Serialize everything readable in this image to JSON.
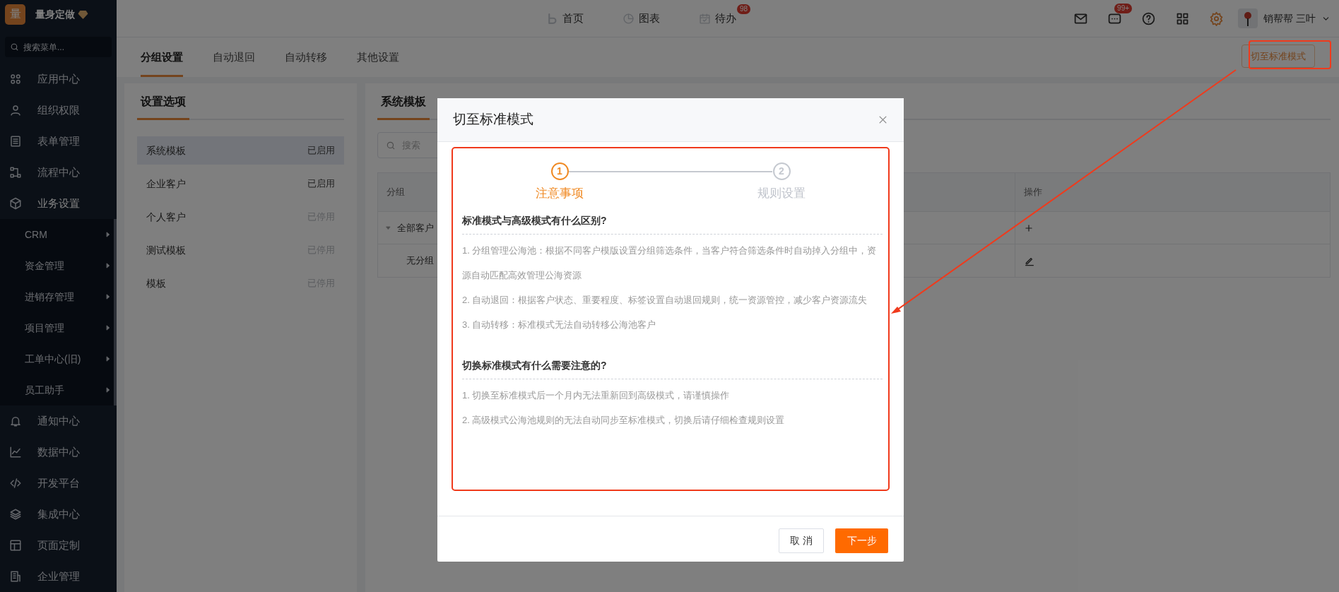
{
  "sidebar": {
    "brand": {
      "logo": "量",
      "name": "量身定做"
    },
    "search": {
      "placeholder": "搜索菜单..."
    },
    "items": [
      {
        "label": "应用中心"
      },
      {
        "label": "组织权限"
      },
      {
        "label": "表单管理"
      },
      {
        "label": "流程中心"
      },
      {
        "label": "业务设置",
        "expanded": true,
        "children": [
          {
            "label": "CRM"
          },
          {
            "label": "资金管理"
          },
          {
            "label": "进销存管理"
          },
          {
            "label": "项目管理"
          },
          {
            "label": "工单中心(旧)"
          },
          {
            "label": "员工助手"
          }
        ]
      },
      {
        "label": "通知中心"
      },
      {
        "label": "数据中心"
      },
      {
        "label": "开发平台"
      },
      {
        "label": "集成中心"
      },
      {
        "label": "页面定制"
      },
      {
        "label": "企业管理"
      }
    ]
  },
  "top_nav": [
    {
      "label": "首页"
    },
    {
      "label": "图表"
    },
    {
      "label": "待办",
      "badge": "98"
    }
  ],
  "chat_badge": "99+",
  "user": {
    "name": "销帮帮 三叶"
  },
  "tabs": [
    {
      "label": "分组设置",
      "selected": true
    },
    {
      "label": "自动退回",
      "selected": false
    },
    {
      "label": "自动转移",
      "selected": false
    },
    {
      "label": "其他设置",
      "selected": false
    }
  ],
  "mode_button": "切至标准模式",
  "settings_panel": {
    "title": "设置选项",
    "items": [
      {
        "label": "系统模板",
        "status": "已启用",
        "enabled": true,
        "selected": true
      },
      {
        "label": "企业客户",
        "status": "已启用",
        "enabled": true,
        "selected": false
      },
      {
        "label": "个人客户",
        "status": "已停用",
        "enabled": false,
        "selected": false
      },
      {
        "label": "测试模板",
        "status": "已停用",
        "enabled": false,
        "selected": false
      },
      {
        "label": "模板",
        "status": "已停用",
        "enabled": false,
        "selected": false
      }
    ]
  },
  "template_panel": {
    "title": "系统模板",
    "search": {
      "placeholder": "搜索"
    },
    "table": {
      "columns": [
        "分组",
        "操作"
      ],
      "rows": [
        {
          "group": "全部客户",
          "expanded": true,
          "kind": "add"
        },
        {
          "group": "无分组",
          "kind": "edit"
        }
      ]
    }
  },
  "modal": {
    "title": "切至标准模式",
    "steps": [
      {
        "number": "1",
        "label": "注意事项",
        "active": true
      },
      {
        "number": "2",
        "label": "规则设置",
        "active": false
      }
    ],
    "sections": [
      {
        "heading": "标准模式与高级模式有什么区别?",
        "items": [
          "1. 分组管理公海池：根据不同客户模版设置分组筛选条件，当客户符合筛选条件时自动掉入分组中，资源自动匹配高效管理公海资源",
          "2. 自动退回：根据客户状态、重要程度、标签设置自动退回规则，统一资源管控，减少客户资源流失",
          "3. 自动转移：标准模式无法自动转移公海池客户"
        ]
      },
      {
        "heading": "切换标准模式有什么需要注意的?",
        "items": [
          "1. 切换至标准模式后一个月内无法重新回到高级模式，请谨慎操作",
          "2. 高级模式公海池规则的无法自动同步至标准模式，切换后请仔细检查规则设置"
        ]
      }
    ],
    "buttons": [
      {
        "label": "取 消",
        "kind": "secondary"
      },
      {
        "label": "下一步",
        "kind": "primary"
      }
    ]
  }
}
